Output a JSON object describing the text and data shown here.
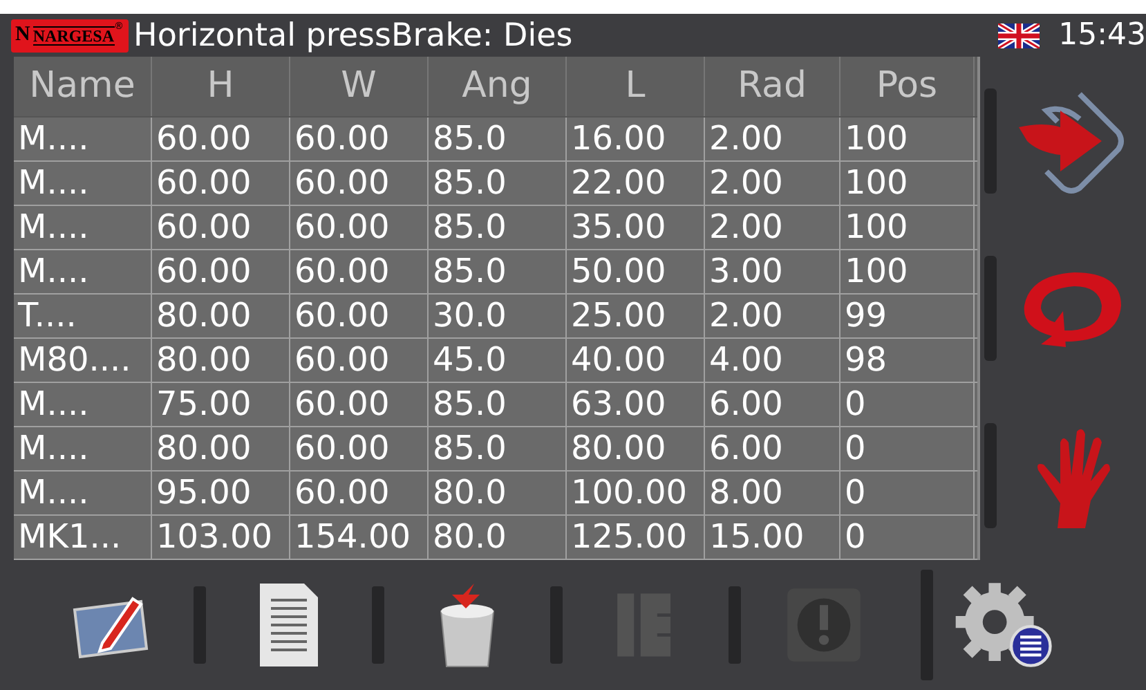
{
  "header": {
    "logo": {
      "mark": "N",
      "name": "NARGESA",
      "registered": "®"
    },
    "title": "Horizontal pressBrake: Dies",
    "time": "15:43"
  },
  "table": {
    "columns": [
      "Name",
      "H",
      "W",
      "Ang",
      "L",
      "Rad",
      "Pos"
    ],
    "rows": [
      [
        "M....",
        "60.00",
        "60.00",
        "85.0",
        "16.00",
        "2.00",
        "100"
      ],
      [
        "M....",
        "60.00",
        "60.00",
        "85.0",
        "22.00",
        "2.00",
        "100"
      ],
      [
        "M....",
        "60.00",
        "60.00",
        "85.0",
        "35.00",
        "2.00",
        "100"
      ],
      [
        "M....",
        "60.00",
        "60.00",
        "85.0",
        "50.00",
        "3.00",
        "100"
      ],
      [
        "T....",
        "80.00",
        "60.00",
        "30.0",
        "25.00",
        "2.00",
        "99"
      ],
      [
        "M80....",
        "80.00",
        "60.00",
        "45.0",
        "40.00",
        "4.00",
        "98"
      ],
      [
        "M....",
        "75.00",
        "60.00",
        "85.0",
        "63.00",
        "6.00",
        "0"
      ],
      [
        "M....",
        "80.00",
        "60.00",
        "85.0",
        "80.00",
        "6.00",
        "0"
      ],
      [
        "M....",
        "95.00",
        "60.00",
        "80.0",
        "100.00",
        "8.00",
        "0"
      ],
      [
        "MK1...",
        "103.00",
        "154.00",
        "80.0",
        "125.00",
        "15.00",
        "0"
      ]
    ]
  },
  "side_buttons": [
    {
      "kind": "enter"
    },
    {
      "kind": "refresh"
    },
    {
      "kind": "stop"
    }
  ],
  "toolbar": [
    {
      "kind": "edit",
      "disabled": false
    },
    {
      "kind": "document",
      "disabled": false
    },
    {
      "kind": "trash",
      "disabled": false
    },
    {
      "kind": "bracket",
      "disabled": true
    },
    {
      "kind": "alert",
      "disabled": true
    }
  ],
  "settings": {
    "kind": "settings"
  }
}
